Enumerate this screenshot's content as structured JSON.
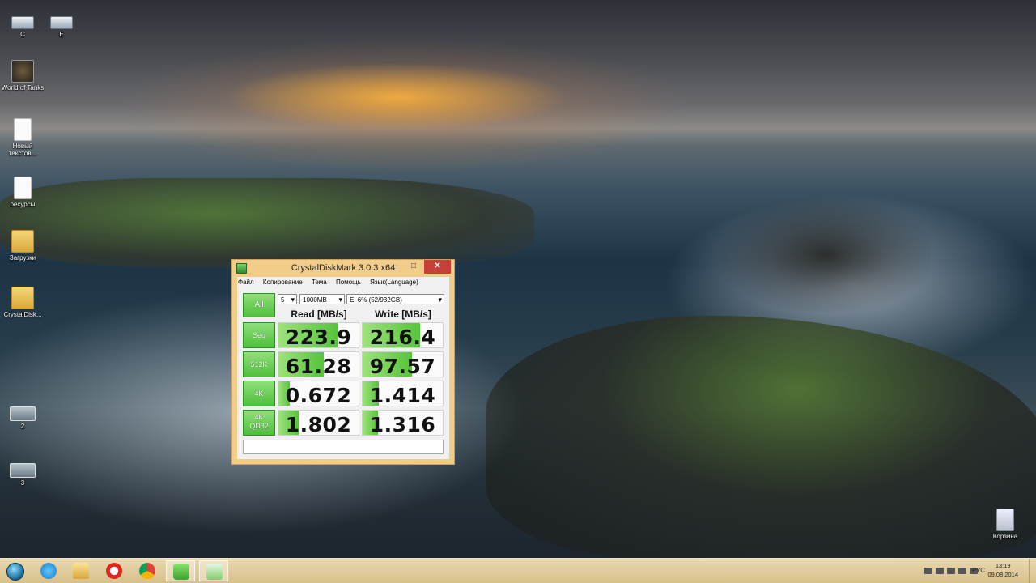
{
  "desktop": {
    "icons": [
      {
        "label": "C",
        "icon": "drive-icon"
      },
      {
        "label": "E",
        "icon": "drive-icon"
      },
      {
        "label": "World of Tanks",
        "icon": "world-of-tanks-icon"
      },
      {
        "label": "Новый текстов...",
        "icon": "text-document-icon"
      },
      {
        "label": "ресурсы",
        "icon": "document-icon"
      },
      {
        "label": "Загрузки",
        "icon": "downloads-folder-icon"
      },
      {
        "label": "CrystalDisk...",
        "icon": "folder-icon"
      },
      {
        "label": "2",
        "icon": "image-thumbnail-icon"
      },
      {
        "label": "3",
        "icon": "image-thumbnail-icon"
      },
      {
        "label": "Корзина",
        "icon": "recycle-bin-icon"
      }
    ]
  },
  "window": {
    "title": "CrystalDiskMark 3.0.3 x64",
    "controls": {
      "minimize": "–",
      "maximize": "□",
      "close": "✕"
    },
    "menu": [
      "Файл",
      "Копирование",
      "Тема",
      "Помощь",
      "Язык(Language)"
    ],
    "selects": {
      "runs": "5",
      "size": "1000MB",
      "drive": "E: 6% (52/932GB)"
    },
    "all_button": "All",
    "headers": {
      "read": "Read [MB/s]",
      "write": "Write [MB/s]"
    },
    "rows": [
      {
        "label": "Seq",
        "read": "223.9",
        "write": "216.4",
        "read_fill": 0.74,
        "write_fill": 0.72
      },
      {
        "label": "512K",
        "read": "61.28",
        "write": "97.57",
        "read_fill": 0.57,
        "write_fill": 0.62
      },
      {
        "label": "4K",
        "read": "0.672",
        "write": "1.414",
        "read_fill": 0.14,
        "write_fill": 0.2
      },
      {
        "label": "4K\nQD32",
        "read": "1.802",
        "write": "1.316",
        "read_fill": 0.25,
        "write_fill": 0.19
      }
    ],
    "status": ""
  },
  "taskbar": {
    "items": [
      {
        "name": "start-button",
        "icon": "windows-start-icon"
      },
      {
        "name": "taskbar-internet-explorer",
        "icon": "internet-explorer-icon"
      },
      {
        "name": "taskbar-file-explorer",
        "icon": "file-explorer-icon"
      },
      {
        "name": "taskbar-opera",
        "icon": "opera-icon"
      },
      {
        "name": "taskbar-chrome",
        "icon": "chrome-icon"
      },
      {
        "name": "taskbar-utorrent",
        "icon": "utorrent-icon"
      },
      {
        "name": "taskbar-crystaldiskmark",
        "icon": "crystaldiskmark-icon"
      }
    ],
    "language": "РУС",
    "time": "13:19",
    "date": "09.08.2014"
  }
}
